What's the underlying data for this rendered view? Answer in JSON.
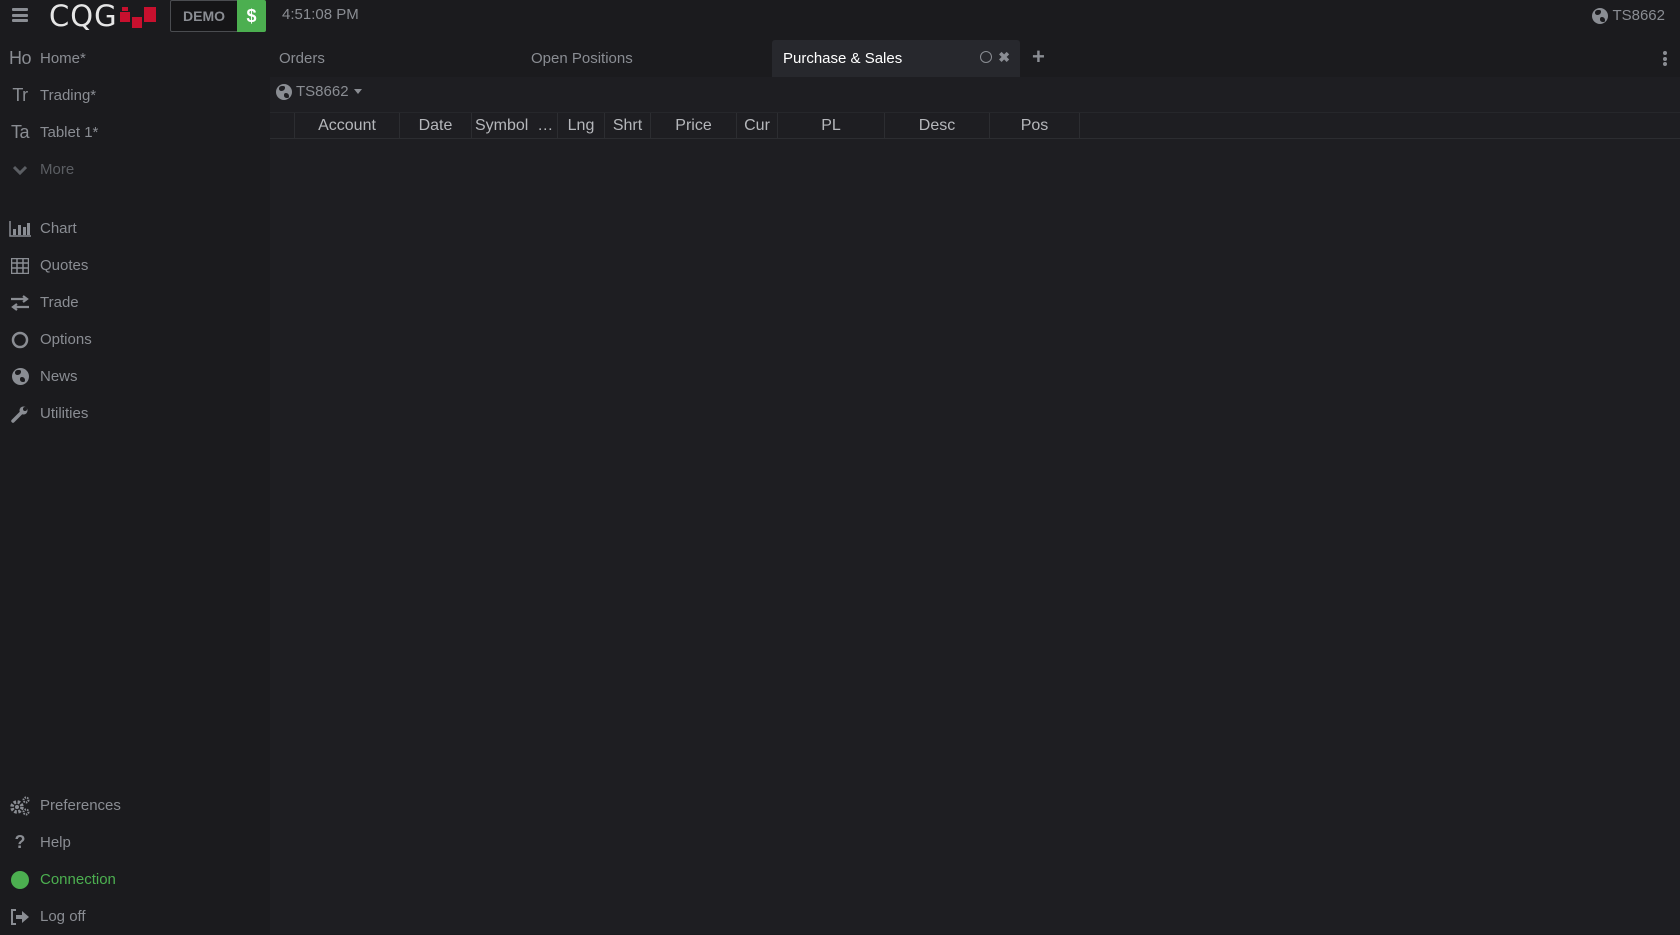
{
  "topbar": {
    "menu_icon": "hamburger-icon",
    "logo_text": "CQG",
    "mode_badge": "DEMO",
    "funds_badge": "$",
    "clock": "4:51:08 PM",
    "account": "TS8662",
    "account_icon": "globe-icon"
  },
  "sidebar": {
    "workspaces": [
      {
        "abbr": "Ho",
        "label": "Home*"
      },
      {
        "abbr": "Tr",
        "label": "Trading*"
      },
      {
        "abbr": "Ta",
        "label": "Tablet 1*"
      }
    ],
    "more_label": "More",
    "tools": [
      {
        "icon": "bar-chart-icon",
        "label": "Chart"
      },
      {
        "icon": "grid-table-icon",
        "label": "Quotes"
      },
      {
        "icon": "exchange-arrows-icon",
        "label": "Trade"
      },
      {
        "icon": "circle-icon",
        "label": "Options"
      },
      {
        "icon": "globe-icon",
        "label": "News"
      },
      {
        "icon": "wrench-icon",
        "label": "Utilities"
      }
    ],
    "bottom": [
      {
        "icon": "gears-icon",
        "label": "Preferences"
      },
      {
        "icon": "question-icon",
        "label": "Help"
      },
      {
        "icon": "status-dot-icon",
        "label": "Connection"
      },
      {
        "icon": "sign-out-icon",
        "label": "Log off"
      }
    ]
  },
  "main": {
    "tabs": [
      {
        "label": "Orders",
        "active": false
      },
      {
        "label": "Open Positions",
        "active": false
      },
      {
        "label": "Purchase & Sales",
        "active": true
      }
    ],
    "add_tab": "+",
    "account_selector": "TS8662",
    "columns": [
      "",
      "Account",
      "Date",
      "Symbol  …",
      "Lng",
      "Shrt",
      "Price",
      "Cur",
      "PL",
      "Desc",
      "Pos"
    ],
    "rows": []
  },
  "colors": {
    "background": "#1b1b1e",
    "panel": "#1e1e22",
    "active_tab": "#27282d",
    "accent_green": "#4caf50",
    "brand_red": "#c8102e",
    "text_muted": "#8a8d93"
  }
}
